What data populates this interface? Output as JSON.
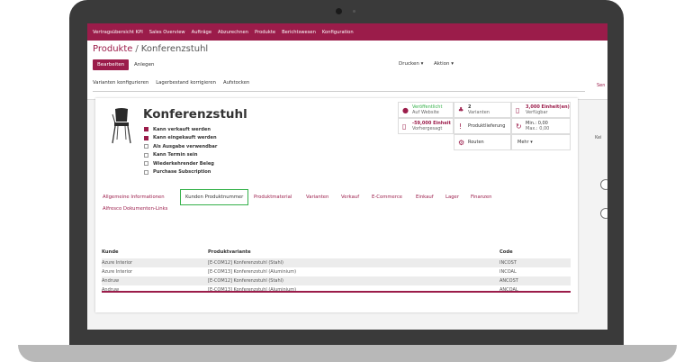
{
  "topnav": [
    "Vertragsübersicht KPI",
    "Sales Overview",
    "Aufträge",
    "Abzurechnen",
    "Produkte",
    "Berichtswesen",
    "Konfiguration"
  ],
  "breadcrumb": {
    "parent": "Produkte",
    "sep": "/",
    "current": "Konferenzstuhl"
  },
  "buttons": {
    "edit": "Bearbeiten",
    "create": "Anlegen",
    "print": "Drucken ▾",
    "action": "Aktion ▾",
    "right_cut": "Sen"
  },
  "header_buttons": [
    "Varianten konfigurieren",
    "Lagerbestand korrigieren",
    "Aufstocken"
  ],
  "product": {
    "name": "Konferenzstuhl",
    "checks": [
      {
        "label": "Kann verkauft werden",
        "checked": true
      },
      {
        "label": "Kann eingekauft werden",
        "checked": true
      },
      {
        "label": "Als Ausgabe verwendbar",
        "checked": false
      },
      {
        "label": "Kann Termin sein",
        "checked": false
      },
      {
        "label": "Wiederkehrender Beleg",
        "checked": false
      },
      {
        "label": "Purchase Subscription",
        "checked": false
      }
    ]
  },
  "smart_buttons": {
    "website": {
      "t1": "Veröffentlicht",
      "t2": "Auf Website",
      "icon": "globe-icon"
    },
    "variants": {
      "t1": "2",
      "t2": "Varianten",
      "icon": "sitemap-icon"
    },
    "available": {
      "t1": "3,000 Einheit(en)",
      "t2": "Verfügbar",
      "icon": "building-icon"
    },
    "forecast": {
      "t1": "-59,000 Einheit",
      "t2": "Vorhergesagt",
      "icon": "building-icon"
    },
    "supply": {
      "t1": "Produktlieferung",
      "t2": "",
      "icon": "exclamation-icon"
    },
    "minmax": {
      "t1": "Min.: 0,00",
      "t2": "Max.: 0,00",
      "icon": "refresh-icon"
    },
    "routes": {
      "t1": "Routen",
      "t2": "",
      "icon": "cogs-icon"
    },
    "more": {
      "t1": "Mehr ▾",
      "t2": ""
    }
  },
  "tabs": [
    "Allgemeine Informationen",
    "Kunden Produktnummer",
    "Produktmaterial",
    "Varianten",
    "Verkauf",
    "E-Commerce",
    "Einkauf",
    "Lager",
    "Finanzen",
    "Alfresco Dokumenten-Links"
  ],
  "table": {
    "headers": [
      "Kunde",
      "Produktvariante",
      "Code"
    ],
    "rows": [
      [
        "Azure Interior",
        "[E-COM12] Konferenzstuhl (Stahl)",
        "INCOST"
      ],
      [
        "Azure Interior",
        "[E-COM13] Konferenzstuhl (Aluminium)",
        "INCOAL"
      ],
      [
        "Andruw",
        "[E-COM12] Konferenzstuhl (Stahl)",
        "ANCOST"
      ],
      [
        "Andruw",
        "[E-COM13] Konferenzstuhl (Aluminium)",
        "ANCOAL"
      ]
    ]
  },
  "side_label": "Kei",
  "colors": {
    "brand": "#9b1c4a",
    "highlight": "#35b14a"
  }
}
